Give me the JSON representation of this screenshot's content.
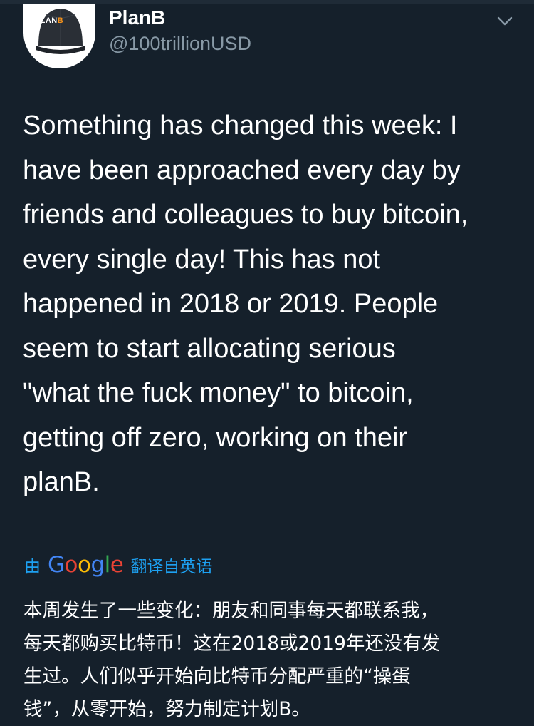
{
  "tweet": {
    "author": {
      "display_name": "PlanB",
      "handle": "@100trillionUSD",
      "avatar_logo_text": "PLAN",
      "avatar_logo_mark": "B"
    },
    "menu_icon": "chevron-down-icon",
    "text_lines": [
      "Something has changed this week: I",
      "have been approached every day by",
      "friends and colleagues to buy bitcoin,",
      "every single day! This has not",
      "happened in 2018 or 2019. People",
      "seem to start allocating serious",
      "\"what the fuck money\" to bitcoin,",
      "getting off zero, working on their",
      "planB."
    ],
    "translation": {
      "prefix": "由",
      "provider_letters": [
        "G",
        "o",
        "o",
        "g",
        "l",
        "e"
      ],
      "suffix": "翻译自英语",
      "lines": [
        "本周发生了一些变化：朋友和同事每天都联系我，",
        "每天都购买比特币！这在2018或2019年还没有发",
        "生过。人们似乎开始向比特币分配严重的“操蛋",
        "钱”，从零开始，努力制定计划B。"
      ]
    }
  },
  "colors": {
    "background": "#15202b",
    "text_primary": "#ffffff",
    "text_secondary": "#8899a6",
    "link": "#1da1f2",
    "google_blue": "#4285f4",
    "google_red": "#ea4335",
    "google_yellow": "#fbbc05",
    "google_green": "#34a853"
  }
}
